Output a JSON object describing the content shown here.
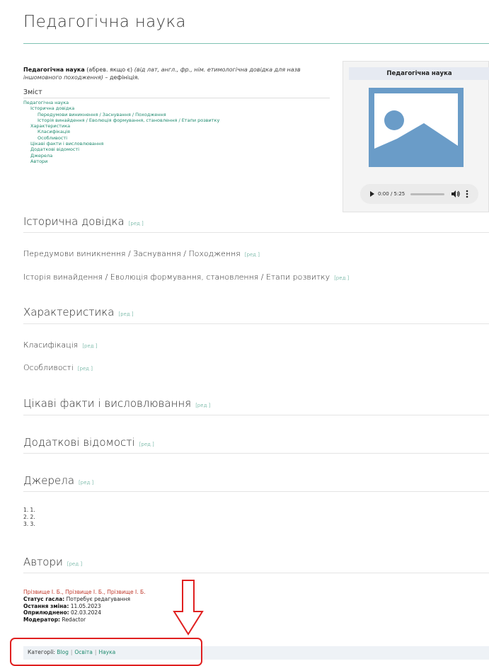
{
  "page": {
    "title": "Педагогічна наука"
  },
  "intro": {
    "term": "Педагогічна наука",
    "abbr": " (абрев. якщо є) ",
    "etymology": "(від лат, англ., фр., нім. етимологічна довідка для назв іншомовного походження)",
    "definition": " – дефініція."
  },
  "toc": {
    "title": "Зміст",
    "items": [
      {
        "label": "Педагогічна наука",
        "level": 1
      },
      {
        "label": "Історична довідка",
        "level": 2
      },
      {
        "label": "Передумови виникнення / Заснування / Походження",
        "level": 3
      },
      {
        "label": "Історія винайдення / Еволюція формування, становлення / Етапи розвитку",
        "level": 3
      },
      {
        "label": "Характеристика",
        "level": 2
      },
      {
        "label": "Класифікація",
        "level": 3
      },
      {
        "label": "Особливості",
        "level": 3
      },
      {
        "label": "Цікаві факти і висловлювання",
        "level": 2
      },
      {
        "label": "Додаткові відомості",
        "level": 2
      },
      {
        "label": "Джерела",
        "level": 2
      },
      {
        "label": "Автори",
        "level": 2
      }
    ]
  },
  "infobox": {
    "title": "Педагогічна наука",
    "image_icon": "image-placeholder-icon",
    "audio": {
      "time": "0:00 / 5:25",
      "progress": 0.0
    }
  },
  "sections": {
    "edit_label": "[ред.]",
    "historical": "Історична довідка",
    "origins": "Передумови виникнення / Заснування / Походження",
    "history": "Історія винайдення / Еволюція формування, становлення / Етапи розвитку",
    "characteristics": "Характеристика",
    "classification": "Класифікація",
    "features": "Особливості",
    "facts": "Цікаві факти і висловлювання",
    "additional": "Додаткові відомості",
    "sources": "Джерела",
    "authors": "Автори"
  },
  "sources_list": [
    "1. 1.",
    "2. 2.",
    "3. 3."
  ],
  "authors_block": {
    "names": "Прізвище І. Б., Прізвище І. Б., Прізвище І. Б.",
    "status_label": "Статус гасла:",
    "status_value": " Потребує редагування",
    "last_change_label": "Остання зміна:",
    "last_change_value": " 11.05.2023",
    "published_label": "Оприлюднено:",
    "published_value": " 02.03.2024",
    "moderator_label": "Модератор:",
    "moderator_value": " Redactor"
  },
  "categories": {
    "label": "Категорії:",
    "items": [
      "Blog",
      "Освіта",
      "Наука"
    ]
  },
  "colors": {
    "accent": "#1f8a6e",
    "annotation": "#e02020",
    "author_link": "#c0392b"
  }
}
